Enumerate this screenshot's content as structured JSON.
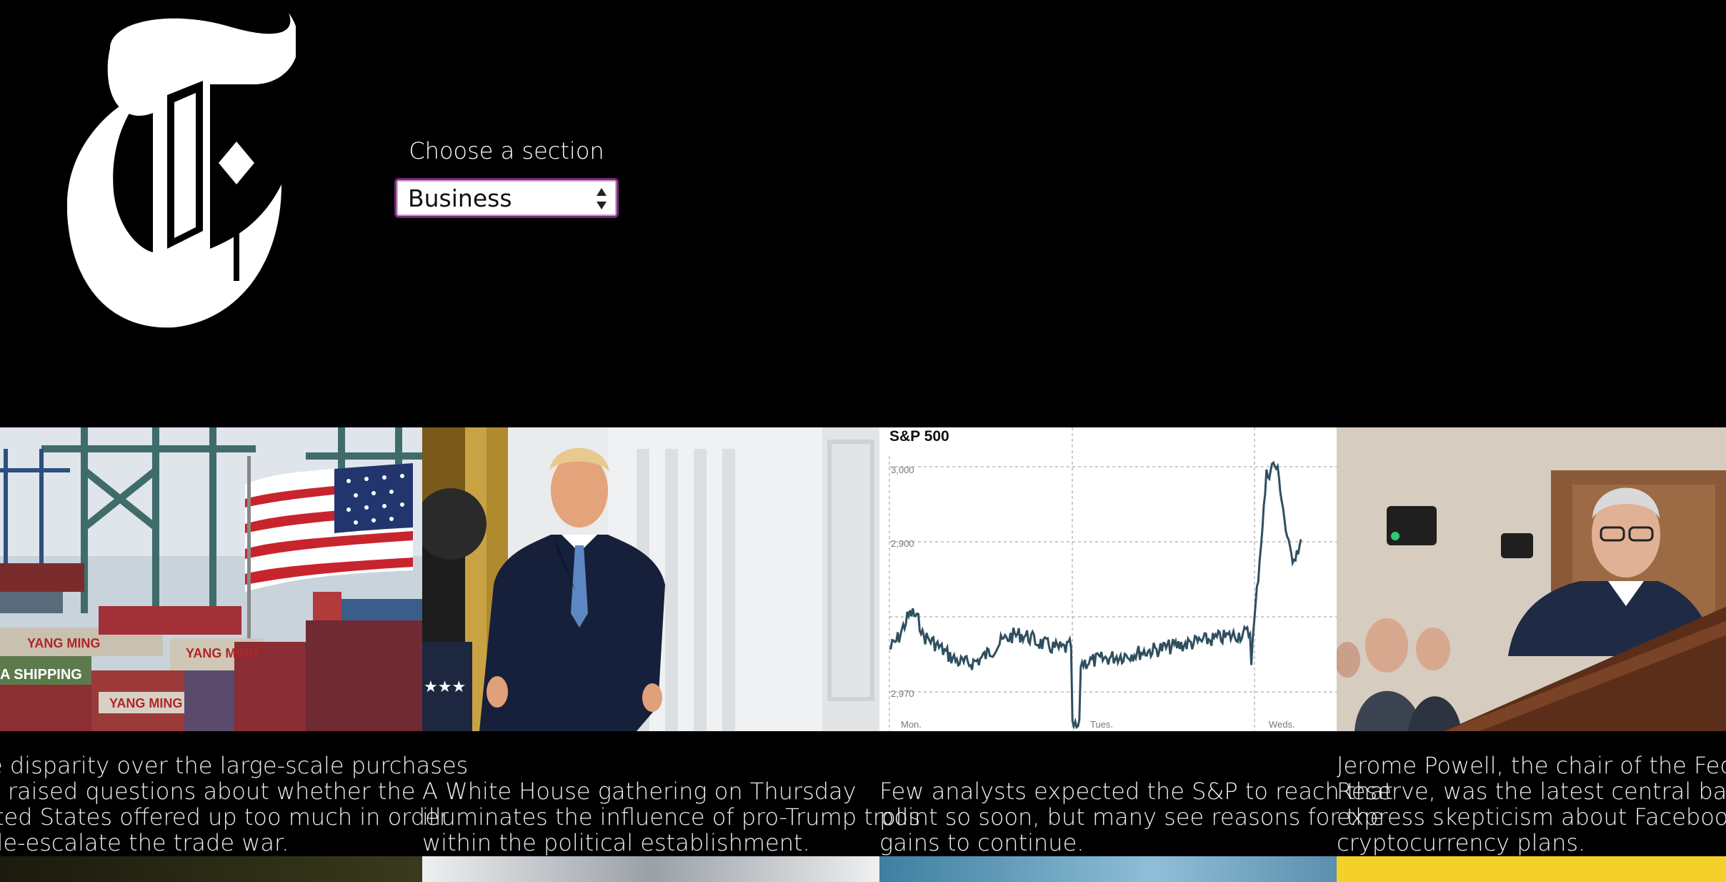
{
  "header": {
    "logo_alt": "T",
    "section_label": "Choose a section",
    "section_selected": "Business"
  },
  "articles": [
    {
      "image_desc": "shipping-port-flag",
      "caption_lines": [
        "e disparity over the large-scale purchases",
        "s raised questions about whether the",
        "ited States offered up too much in order",
        "de-escalate the trade war."
      ],
      "image_labels": [
        "YANG MING",
        "YANG MING",
        "A SHIPPING",
        "YANG MING"
      ]
    },
    {
      "image_desc": "president-portrait",
      "caption_lines": [
        "A White House gathering on Thursday",
        "illuminates the influence of pro-Trump trolls",
        "within the political establishment."
      ]
    },
    {
      "image_desc": "sp500-chart",
      "caption_lines": [
        "Few analysts expected the S&P to reach that",
        "point so soon, but many see reasons for the",
        "gains to continue."
      ]
    },
    {
      "image_desc": "fed-chair-hearing",
      "caption_lines": [
        "Jerome Powell, the chair of the Federal",
        "Reserve, was the latest central banker",
        "express skepticism about Facebook’s",
        "cryptocurrency plans."
      ]
    }
  ],
  "chart_data": {
    "type": "line",
    "title": "S&P 500",
    "y_ticks": [
      "3,000",
      "2,900",
      "2,970"
    ],
    "x_ticks": [
      "Mon.",
      "Tues.",
      "Weds."
    ],
    "series": [
      {
        "values": [
          2890,
          2905,
          2895,
          2900,
          2885,
          2893,
          2888,
          2896,
          2902,
          2880,
          2890,
          2886,
          2894,
          2899,
          2892,
          2898,
          2991,
          2960,
          2985,
          2970,
          2950,
          2980
        ]
      }
    ]
  },
  "colors": {
    "background": "#000000",
    "select_border": "#7a2a7c",
    "chart_line": "#2f4f5f"
  }
}
